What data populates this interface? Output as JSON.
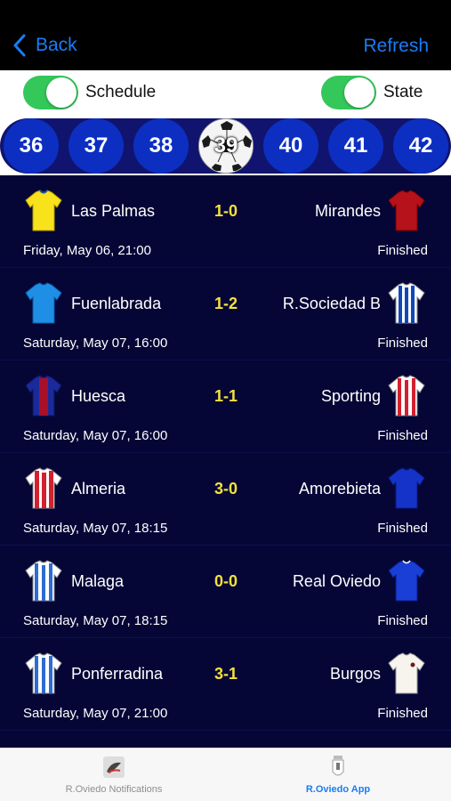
{
  "nav": {
    "back_label": "Back",
    "refresh_label": "Refresh"
  },
  "toggles": {
    "schedule_label": "Schedule",
    "state_label": "State",
    "schedule_on": true,
    "state_on": true
  },
  "rounds": {
    "items": [
      "36",
      "37",
      "38",
      "39",
      "40",
      "41",
      "42"
    ],
    "selected": "39"
  },
  "matches": [
    {
      "home": "Las Palmas",
      "away": "Mirandes",
      "score": "1-0",
      "date": "Friday, May 06, 21:00",
      "status": "Finished"
    },
    {
      "home": "Fuenlabrada",
      "away": "R.Sociedad B",
      "score": "1-2",
      "date": "Saturday, May 07, 16:00",
      "status": "Finished"
    },
    {
      "home": "Huesca",
      "away": "Sporting",
      "score": "1-1",
      "date": "Saturday, May 07, 16:00",
      "status": "Finished"
    },
    {
      "home": "Almeria",
      "away": "Amorebieta",
      "score": "3-0",
      "date": "Saturday, May 07, 18:15",
      "status": "Finished"
    },
    {
      "home": "Malaga",
      "away": "Real Oviedo",
      "score": "0-0",
      "date": "Saturday, May 07, 18:15",
      "status": "Finished"
    },
    {
      "home": "Ponferradina",
      "away": "Burgos",
      "score": "3-1",
      "date": "Saturday, May 07, 21:00",
      "status": "Finished"
    }
  ],
  "tabs": {
    "notifications_label": "R.Oviedo Notifications",
    "app_label": "R.Oviedo App"
  },
  "colors": {
    "accent": "#1a7cf5",
    "switch_on": "#34c759",
    "score": "#f5e13a",
    "list_bg": "#050636",
    "round_bg": "#0c2fc2"
  }
}
